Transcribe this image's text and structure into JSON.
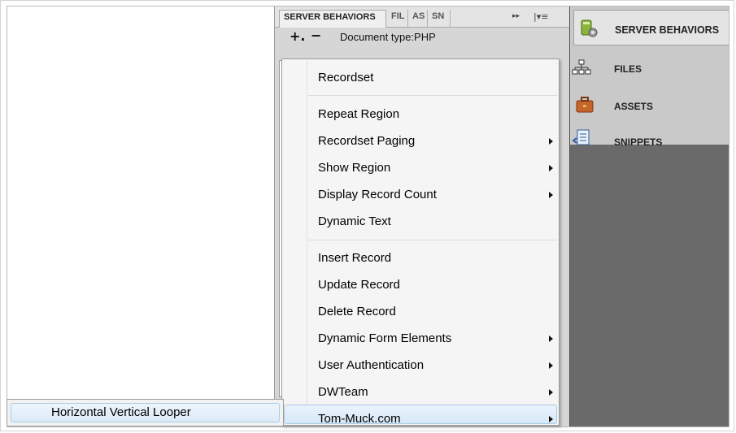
{
  "server_behaviors_panel": {
    "tabs": [
      {
        "label": "SERVER BEHAVIORS"
      },
      {
        "label": "FIL"
      },
      {
        "label": "AS"
      },
      {
        "label": "SN"
      }
    ],
    "overflow_arrows": "▸▸",
    "panel_menu_icon": "|▾≡",
    "toolbar": {
      "add_label": "+.",
      "remove_label": "−",
      "document_type": "Document type:PHP"
    }
  },
  "collapsed_panels": [
    {
      "label": "SERVER BEHAVIORS",
      "icon": "server-behaviors-icon",
      "active": true
    },
    {
      "label": "FILES",
      "icon": "files-icon",
      "active": false
    },
    {
      "label": "ASSETS",
      "icon": "assets-icon",
      "active": false
    },
    {
      "label": "SNIPPETS",
      "icon": "snippets-icon",
      "active": false
    }
  ],
  "context_menu": {
    "items": [
      {
        "label": "Recordset",
        "submenu": false
      },
      {
        "label": "Repeat Region",
        "submenu": false
      },
      {
        "label": "Recordset Paging",
        "submenu": true
      },
      {
        "label": "Show Region",
        "submenu": true
      },
      {
        "label": "Display Record Count",
        "submenu": true
      },
      {
        "label": "Dynamic Text",
        "submenu": false
      },
      {
        "label": "Insert Record",
        "submenu": false
      },
      {
        "label": "Update Record",
        "submenu": false
      },
      {
        "label": "Delete Record",
        "submenu": false
      },
      {
        "label": "Dynamic Form Elements",
        "submenu": true
      },
      {
        "label": "User Authentication",
        "submenu": true
      },
      {
        "label": "DWTeam",
        "submenu": true
      },
      {
        "label": "Tom-Muck.com",
        "submenu": true,
        "highlighted": true
      }
    ]
  },
  "submenu": {
    "items": [
      {
        "label": "Horizontal Vertical Looper",
        "highlighted": true
      }
    ]
  },
  "colors": {
    "panel_bg": "#d6d6d6",
    "dark_panel_bg": "#6a6a6a",
    "menu_bg": "#f5f5f5",
    "highlight_border": "#a8cbe8"
  }
}
